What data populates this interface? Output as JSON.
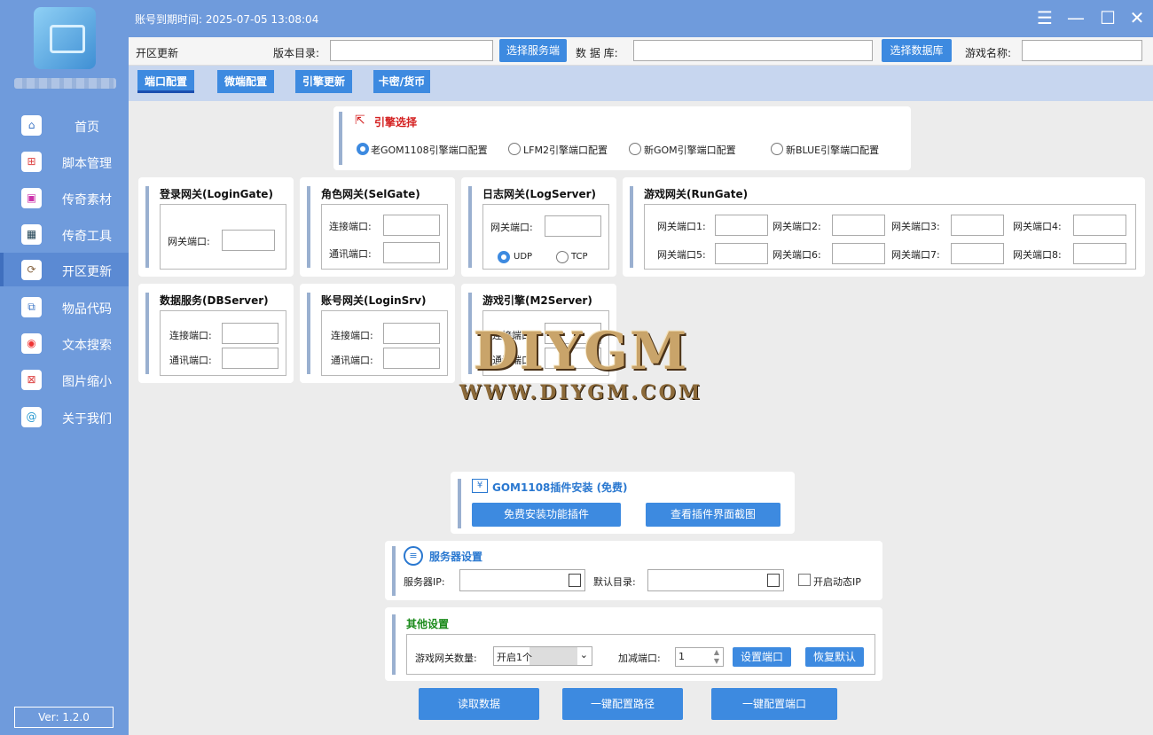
{
  "app": {
    "expire_label": "账号到期时间:",
    "expire_value": "2025-07-05 13:08:04",
    "version": "Ver: 1.2.0"
  },
  "sidebar": {
    "items": [
      {
        "label": "首页",
        "icon": "home-icon"
      },
      {
        "label": "脚本管理",
        "icon": "script-icon"
      },
      {
        "label": "传奇素材",
        "icon": "image-icon"
      },
      {
        "label": "传奇工具",
        "icon": "grid-icon"
      },
      {
        "label": "开区更新",
        "icon": "refresh-icon",
        "active": true
      },
      {
        "label": "物品代码",
        "icon": "code-icon"
      },
      {
        "label": "文本搜索",
        "icon": "search-icon"
      },
      {
        "label": "图片缩小",
        "icon": "shrink-icon"
      },
      {
        "label": "关于我们",
        "icon": "at-icon"
      }
    ]
  },
  "toprow": {
    "page": "开区更新",
    "version_dir": "版本目录:",
    "select_server": "选择服务端",
    "database": "数 据 库:",
    "select_db": "选择数据库",
    "game_name": "游戏名称:"
  },
  "tabs": [
    "端口配置",
    "微端配置",
    "引擎更新",
    "卡密/货币"
  ],
  "engine": {
    "title": "引擎选择",
    "options": [
      "老GOM1108引擎端口配置",
      "LFM2引擎端口配置",
      "新GOM引擎端口配置",
      "新BLUE引擎端口配置"
    ]
  },
  "login_gate": {
    "title": "登录网关(LoginGate)",
    "port": "网关端口:"
  },
  "sel_gate": {
    "title": "角色网关(SelGate)",
    "conn": "连接端口:",
    "comm": "通讯端口:"
  },
  "log_server": {
    "title": "日志网关(LogServer)",
    "port": "网关端口:",
    "udp": "UDP",
    "tcp": "TCP"
  },
  "run_gate": {
    "title": "游戏网关(RunGate)",
    "ports": [
      "网关端口1:",
      "网关端口2:",
      "网关端口3:",
      "网关端口4:",
      "网关端口5:",
      "网关端口6:",
      "网关端口7:",
      "网关端口8:"
    ]
  },
  "db_server": {
    "title": "数据服务(DBServer)",
    "conn": "连接端口:",
    "comm": "通讯端口:"
  },
  "login_srv": {
    "title": "账号网关(LoginSrv)",
    "conn": "连接端口:",
    "comm": "通讯端口:"
  },
  "m2_server": {
    "title": "游戏引擎(M2Server)",
    "conn": "连接端口:",
    "comm": "通讯端口:"
  },
  "watermark": {
    "line1": "DIYGM",
    "line2": "WWW.DIYGM.COM"
  },
  "plugin": {
    "title": "GOM1108插件安装 (免费)",
    "install": "免费安装功能插件",
    "view": "查看插件界面截图"
  },
  "server": {
    "title": "服务器设置",
    "ip": "服务器IP:",
    "dir": "默认目录:",
    "dynamic": "开启动态IP"
  },
  "other": {
    "title": "其他设置",
    "gate_count": "游戏网关数量:",
    "gate_value": "开启1个",
    "inc_port": "加减端口:",
    "inc_value": "1",
    "set_port": "设置端口",
    "restore": "恢复默认"
  },
  "actions": {
    "read": "读取数据",
    "path": "一键配置路径",
    "port": "一键配置端口"
  },
  "colors": {
    "sidebar": "#6f9bdc",
    "accent": "#3d8ae0",
    "engine_title": "#d42020",
    "other_title": "#1a8a1a",
    "plugin_title": "#2a78d0"
  }
}
